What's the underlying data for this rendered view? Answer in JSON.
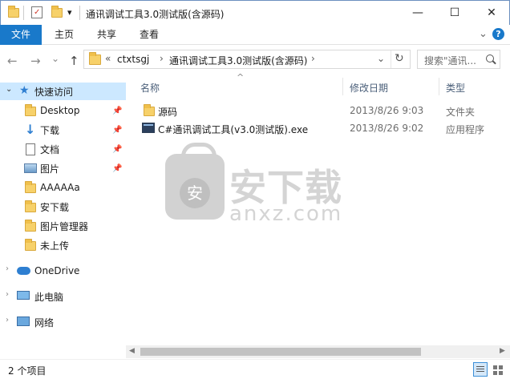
{
  "window": {
    "title": "通讯调试工具3.0测试版(含源码)",
    "qat_dropdown": "▾",
    "controls": {
      "minimize": "—",
      "maximize": "☐",
      "close": "✕"
    }
  },
  "ribbon": {
    "tabs": [
      "文件",
      "主页",
      "共享",
      "查看"
    ],
    "collapse_chevron": "⌄",
    "help": "?"
  },
  "nav": {
    "back": "←",
    "forward": "→",
    "recent": "⌄",
    "up": "↑",
    "breadcrumb": [
      "ctxtsgj",
      "通讯调试工具3.0测试版(含源码)"
    ],
    "overflow": "«",
    "separator": "›",
    "dropdown": "⌄",
    "refresh": "↻",
    "search_placeholder": "搜索\"通讯...",
    "search_icon": "magnifier-icon"
  },
  "sidebar": {
    "quick_access": "快速访问",
    "items": [
      {
        "label": "Desktop",
        "icon": "folder-icon",
        "pinned": true
      },
      {
        "label": "下载",
        "icon": "download-arrow-icon",
        "pinned": true
      },
      {
        "label": "文档",
        "icon": "document-icon",
        "pinned": true
      },
      {
        "label": "图片",
        "icon": "picture-icon",
        "pinned": true
      },
      {
        "label": "AAAAAa",
        "icon": "folder-icon",
        "pinned": false
      },
      {
        "label": "安下载",
        "icon": "folder-icon",
        "pinned": false
      },
      {
        "label": "图片管理器",
        "icon": "folder-icon",
        "pinned": false
      },
      {
        "label": "未上传",
        "icon": "folder-icon",
        "pinned": false
      }
    ],
    "onedrive": "OneDrive",
    "this_pc": "此电脑",
    "network": "网络",
    "pin_glyph": "📌"
  },
  "table": {
    "sort_indicator": "^",
    "headers": {
      "name": "名称",
      "date": "修改日期",
      "type": "类型"
    },
    "rows": [
      {
        "name": "源码",
        "date": "2013/8/26 9:03",
        "type": "文件夹",
        "icon": "folder-icon"
      },
      {
        "name": "C#通讯调试工具(v3.0测试版).exe",
        "date": "2013/8/26 9:02",
        "type": "应用程序",
        "icon": "exe-window-icon"
      }
    ]
  },
  "statusbar": {
    "count": "2 个项目"
  },
  "watermark": {
    "cn": "安下载",
    "en": "anxz.com",
    "badge": "安"
  },
  "colors": {
    "accent": "#1979ca",
    "quick_access_star": "#2f7fd1",
    "header_text": "#4c607a"
  }
}
